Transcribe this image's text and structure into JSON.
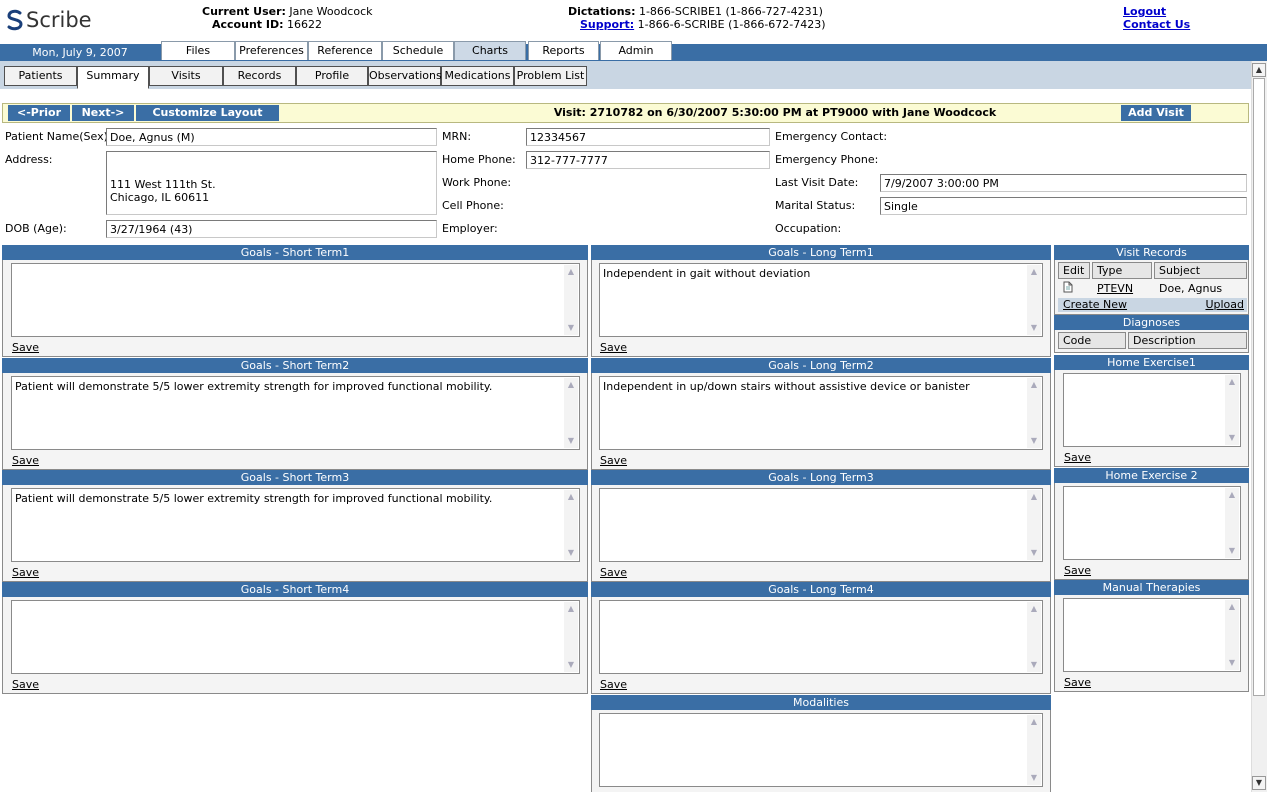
{
  "brand": {
    "logo_text": "Scribe"
  },
  "header": {
    "current_user_label": "Current User:",
    "current_user": "Jane Woodcock",
    "account_label": "Account ID:",
    "account_id": "16622",
    "dictations_label": "Dictations:",
    "dictations": "1-866-SCRIBE1 (1-866-727-4231)",
    "support_label": "Support:",
    "support": "1-866-6-SCRIBE (1-866-672-7423)",
    "logout": "Logout",
    "contact": "Contact Us"
  },
  "date": "Mon, July 9, 2007",
  "main_tabs": [
    "Files",
    "Preferences",
    "Reference",
    "Schedule",
    "Charts",
    "Reports",
    "Admin"
  ],
  "sub_tabs": [
    "Patients",
    "Summary",
    "Visits",
    "Records",
    "Profile",
    "Observations",
    "Medications",
    "Problem List"
  ],
  "visit_bar": {
    "prior": "<-Prior",
    "next": "Next->",
    "customize": "Customize Layout",
    "title": "Visit: 2710782 on 6/30/2007 5:30:00 PM at PT9000 with Jane Woodcock",
    "add_visit": "Add Visit"
  },
  "patient": {
    "name_label": "Patient Name(Sex):",
    "name": "Doe, Agnus (M)",
    "address_label": "Address:",
    "address_line1": "111 West 111th St.",
    "address_line2": "Chicago, IL 60611",
    "dob_label": "DOB (Age):",
    "dob": "3/27/1964 (43)",
    "mrn_label": "MRN:",
    "mrn": "12334567",
    "home_phone_label": "Home Phone:",
    "home_phone": "312-777-7777",
    "work_phone_label": "Work Phone:",
    "cell_phone_label": "Cell Phone:",
    "employer_label": "Employer:",
    "emergency_contact_label": "Emergency Contact:",
    "emergency_phone_label": "Emergency Phone:",
    "last_visit_label": "Last Visit Date:",
    "last_visit": "7/9/2007 3:00:00 PM",
    "marital_label": "Marital Status:",
    "marital": "Single",
    "occupation_label": "Occupation:"
  },
  "save_label": "Save",
  "panels": {
    "st1": {
      "title": "Goals - Short Term1",
      "text": ""
    },
    "st2": {
      "title": "Goals - Short Term2",
      "text": "Patient will demonstrate 5/5 lower extremity strength for improved functional mobility."
    },
    "st3": {
      "title": "Goals - Short Term3",
      "text": "Patient will demonstrate 5/5 lower extremity strength for improved functional mobility."
    },
    "st4": {
      "title": "Goals - Short Term4",
      "text": ""
    },
    "lt1": {
      "title": "Goals - Long Term1",
      "text": "Independent in gait without deviation"
    },
    "lt2": {
      "title": "Goals - Long Term2",
      "text": "Independent in up/down stairs without assistive device or banister"
    },
    "lt3": {
      "title": "Goals - Long Term3",
      "text": ""
    },
    "lt4": {
      "title": "Goals - Long Term4",
      "text": ""
    },
    "mod": {
      "title": "Modalities",
      "text": ""
    },
    "he1": {
      "title": "Home Exercise1",
      "text": ""
    },
    "he2": {
      "title": "Home Exercise 2",
      "text": ""
    },
    "mt": {
      "title": "Manual Therapies",
      "text": ""
    }
  },
  "visit_records": {
    "title": "Visit Records",
    "cols": [
      "Edit",
      "Type",
      "Subject"
    ],
    "row": {
      "type": "PTEVN",
      "subject": "Doe, Agnus"
    },
    "create_new": "Create New",
    "upload": "Upload"
  },
  "diagnoses": {
    "title": "Diagnoses",
    "cols": [
      "Code",
      "Description"
    ]
  }
}
